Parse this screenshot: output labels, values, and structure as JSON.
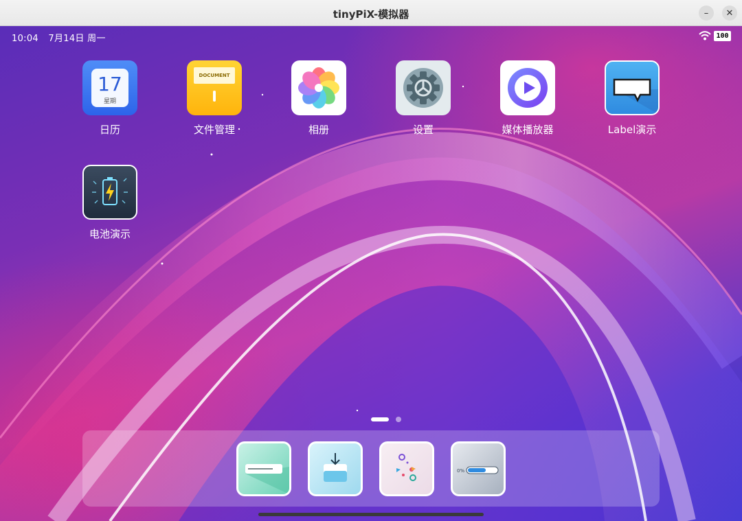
{
  "window": {
    "title": "tinyPiX-模拟器",
    "minimize_glyph": "–",
    "close_glyph": "✕"
  },
  "status_bar": {
    "time": "10:04",
    "date": "7月14日 周一",
    "battery_level": "100",
    "wifi_icon": "wifi-icon"
  },
  "apps": [
    {
      "label": "日历",
      "icon": "calendar-icon",
      "calendar_day": "17",
      "calendar_sub": "星期"
    },
    {
      "label": "文件管理",
      "icon": "folder-document-icon",
      "doc_text": "DOCUMENT"
    },
    {
      "label": "相册",
      "icon": "photos-flower-icon"
    },
    {
      "label": "设置",
      "icon": "gear-icon"
    },
    {
      "label": "媒体播放器",
      "icon": "play-icon"
    },
    {
      "label": "Label演示",
      "icon": "speech-bubble-icon"
    },
    {
      "label": "电池演示",
      "icon": "battery-charging-icon"
    }
  ],
  "pager": {
    "pages": 2,
    "current": 1
  },
  "dock": [
    {
      "icon": "text-field-icon"
    },
    {
      "icon": "download-tray-icon"
    },
    {
      "icon": "graph-nodes-icon"
    },
    {
      "icon": "progress-bar-icon",
      "progress_label": "0%"
    }
  ],
  "colors": {
    "calendar": "#2d64ea",
    "files": "#ffb40c",
    "label_app": "#2f8be0",
    "battery_app": "#1f2c3d"
  }
}
